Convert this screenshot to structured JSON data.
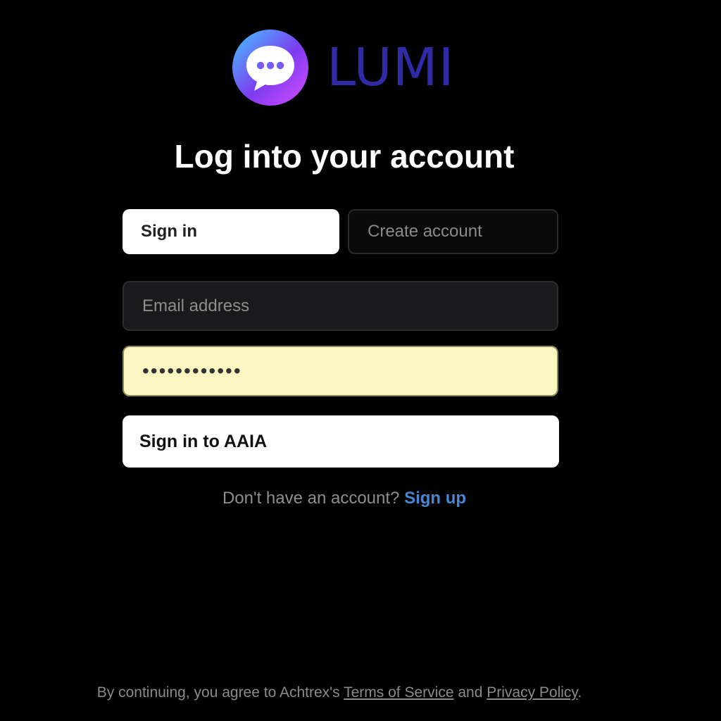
{
  "brand": {
    "name": "LUMI",
    "logo_icon": "chat-bubble-icon",
    "colors": {
      "wordmark": "#2f2aa6",
      "gradient": [
        "#41c6ff",
        "#7d3cf0",
        "#d94cff"
      ]
    }
  },
  "heading": "Log into your account",
  "tabs": [
    {
      "label": "Sign in",
      "active": true
    },
    {
      "label": "Create account",
      "active": false
    }
  ],
  "form": {
    "email": {
      "placeholder": "Email address",
      "value": ""
    },
    "password": {
      "value": "••••••••••••"
    },
    "submit_label": "Sign in to AAIA"
  },
  "signup": {
    "prompt": "Don't have an account?",
    "link_label": "Sign up",
    "link_color": "#4b86d4"
  },
  "footer": {
    "prefix": "By continuing, you agree to Achtrex's",
    "terms_label": "Terms of Service",
    "conjunction": "and",
    "privacy_label": "Privacy Policy",
    "suffix": "."
  }
}
